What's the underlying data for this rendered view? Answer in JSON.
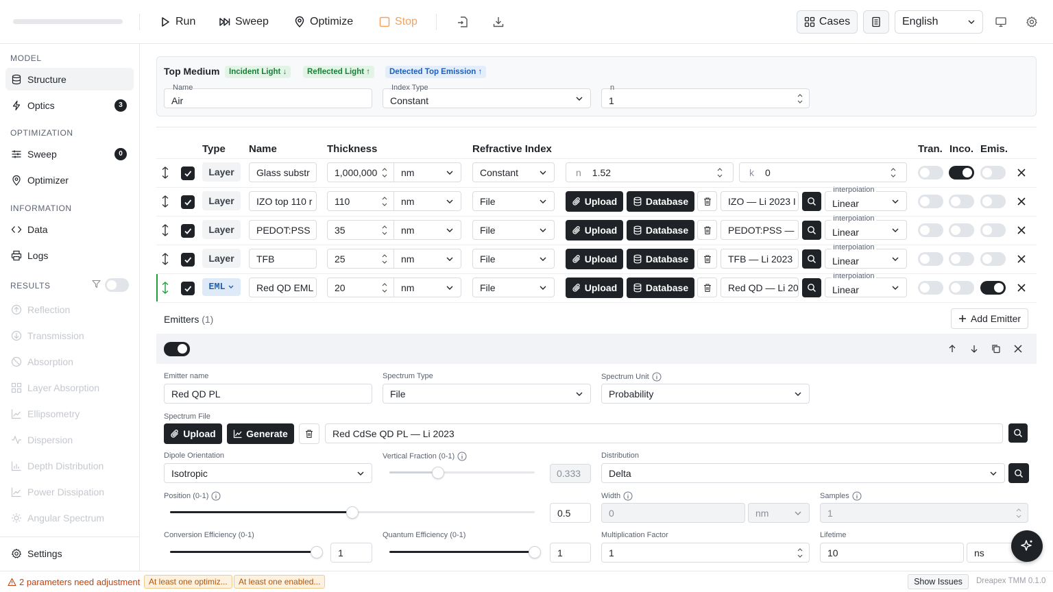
{
  "toolbar": {
    "run": "Run",
    "sweep": "Sweep",
    "optimize": "Optimize",
    "stop": "Stop",
    "cases": "Cases",
    "language": "English",
    "stop_color": "#f0a35e"
  },
  "sidebar": {
    "sections": {
      "model": "MODEL",
      "optimization": "OPTIMIZATION",
      "information": "INFORMATION",
      "results": "RESULTS"
    },
    "items": {
      "structure": "Structure",
      "optics": "Optics",
      "optics_badge": "3",
      "sweep": "Sweep",
      "sweep_badge": "0",
      "optimizer": "Optimizer",
      "data": "Data",
      "logs": "Logs",
      "settings": "Settings"
    },
    "results": [
      "Reflection",
      "Transmission",
      "Absorption",
      "Layer Absorption",
      "Ellipsometry",
      "Dispersion",
      "Depth Distribution",
      "Power Dissipation",
      "Angular Spectrum"
    ]
  },
  "top_medium": {
    "title": "Top Medium",
    "pills": [
      "Incident Light ↓",
      "Reflected Light ↑",
      "Detected Top Emission ↑"
    ],
    "name_label": "Name",
    "name_value": "Air",
    "index_type_label": "Index Type",
    "index_type_value": "Constant",
    "n_label": "n",
    "n_value": "1"
  },
  "table": {
    "headers": {
      "type": "Type",
      "name": "Name",
      "thickness": "Thickness",
      "refractive_index": "Refractive Index",
      "tran": "Tran.",
      "inco": "Inco.",
      "emis": "Emis."
    },
    "rows": [
      {
        "type": "Layer",
        "name": "Glass substr",
        "thickness": "1,000,000",
        "unit": "nm",
        "index_type": "Constant",
        "n_prefix": "n",
        "n": "1.52",
        "k_prefix": "k",
        "k": "0",
        "tran": false,
        "inco": true,
        "emis": false
      },
      {
        "type": "Layer",
        "name": "IZO top 110 r",
        "thickness": "110",
        "unit": "nm",
        "index_type": "File",
        "material": "IZO — Li 2023 I",
        "interp_label": "Interpolation",
        "interp": "Linear",
        "tran": false,
        "inco": false,
        "emis": false
      },
      {
        "type": "Layer",
        "name": "PEDOT:PSS",
        "thickness": "35",
        "unit": "nm",
        "index_type": "File",
        "material": "PEDOT:PSS —",
        "interp_label": "Interpolation",
        "interp": "Linear",
        "tran": false,
        "inco": false,
        "emis": false
      },
      {
        "type": "Layer",
        "name": "TFB",
        "thickness": "25",
        "unit": "nm",
        "index_type": "File",
        "material": "TFB — Li 2023",
        "interp_label": "Interpolation",
        "interp": "Linear",
        "tran": false,
        "inco": false,
        "emis": false
      },
      {
        "type": "EML",
        "name": "Red QD EML",
        "thickness": "20",
        "unit": "nm",
        "index_type": "File",
        "material": "Red QD — Li 20",
        "interp_label": "Interpolation",
        "interp": "Linear",
        "tran": false,
        "inco": false,
        "emis": true
      }
    ],
    "upload_label": "Upload",
    "database_label": "Database"
  },
  "emitters": {
    "title": "Emitters",
    "count": "(1)",
    "add_label": "Add Emitter",
    "emitter_name_label": "Emitter name",
    "emitter_name": "Red QD PL",
    "spectrum_type_label": "Spectrum Type",
    "spectrum_type": "File",
    "spectrum_unit_label": "Spectrum Unit",
    "spectrum_unit": "Probability",
    "spectrum_file_label": "Spectrum File",
    "upload_label": "Upload",
    "generate_label": "Generate",
    "spectrum_file": "Red CdSe QD PL — Li 2023",
    "dipole_label": "Dipole Orientation",
    "dipole": "Isotropic",
    "vertical_fraction_label": "Vertical Fraction (0-1)",
    "vertical_fraction": "0.333",
    "vertical_fraction_level": 0.333,
    "distribution_label": "Distribution",
    "distribution": "Delta",
    "position_label": "Position (0-1)",
    "position": "0.5",
    "position_level": 0.5,
    "width_label": "Width",
    "width": "0",
    "width_unit": "nm",
    "samples_label": "Samples",
    "samples": "1",
    "conversion_label": "Conversion Efficiency (0-1)",
    "conversion": "1",
    "conversion_level": 1,
    "quantum_label": "Quantum Efficiency (0-1)",
    "quantum": "1",
    "quantum_level": 1,
    "multiplication_label": "Multiplication Factor",
    "multiplication": "1",
    "lifetime_label": "Lifetime",
    "lifetime": "10",
    "lifetime_unit": "ns"
  },
  "status": {
    "warning": "2 parameters need adjustment",
    "pill1": "At least one optimiz...",
    "pill2": "At least one enabled...",
    "show_issues": "Show Issues",
    "version": "Dreapex TMM 0.1.0"
  }
}
